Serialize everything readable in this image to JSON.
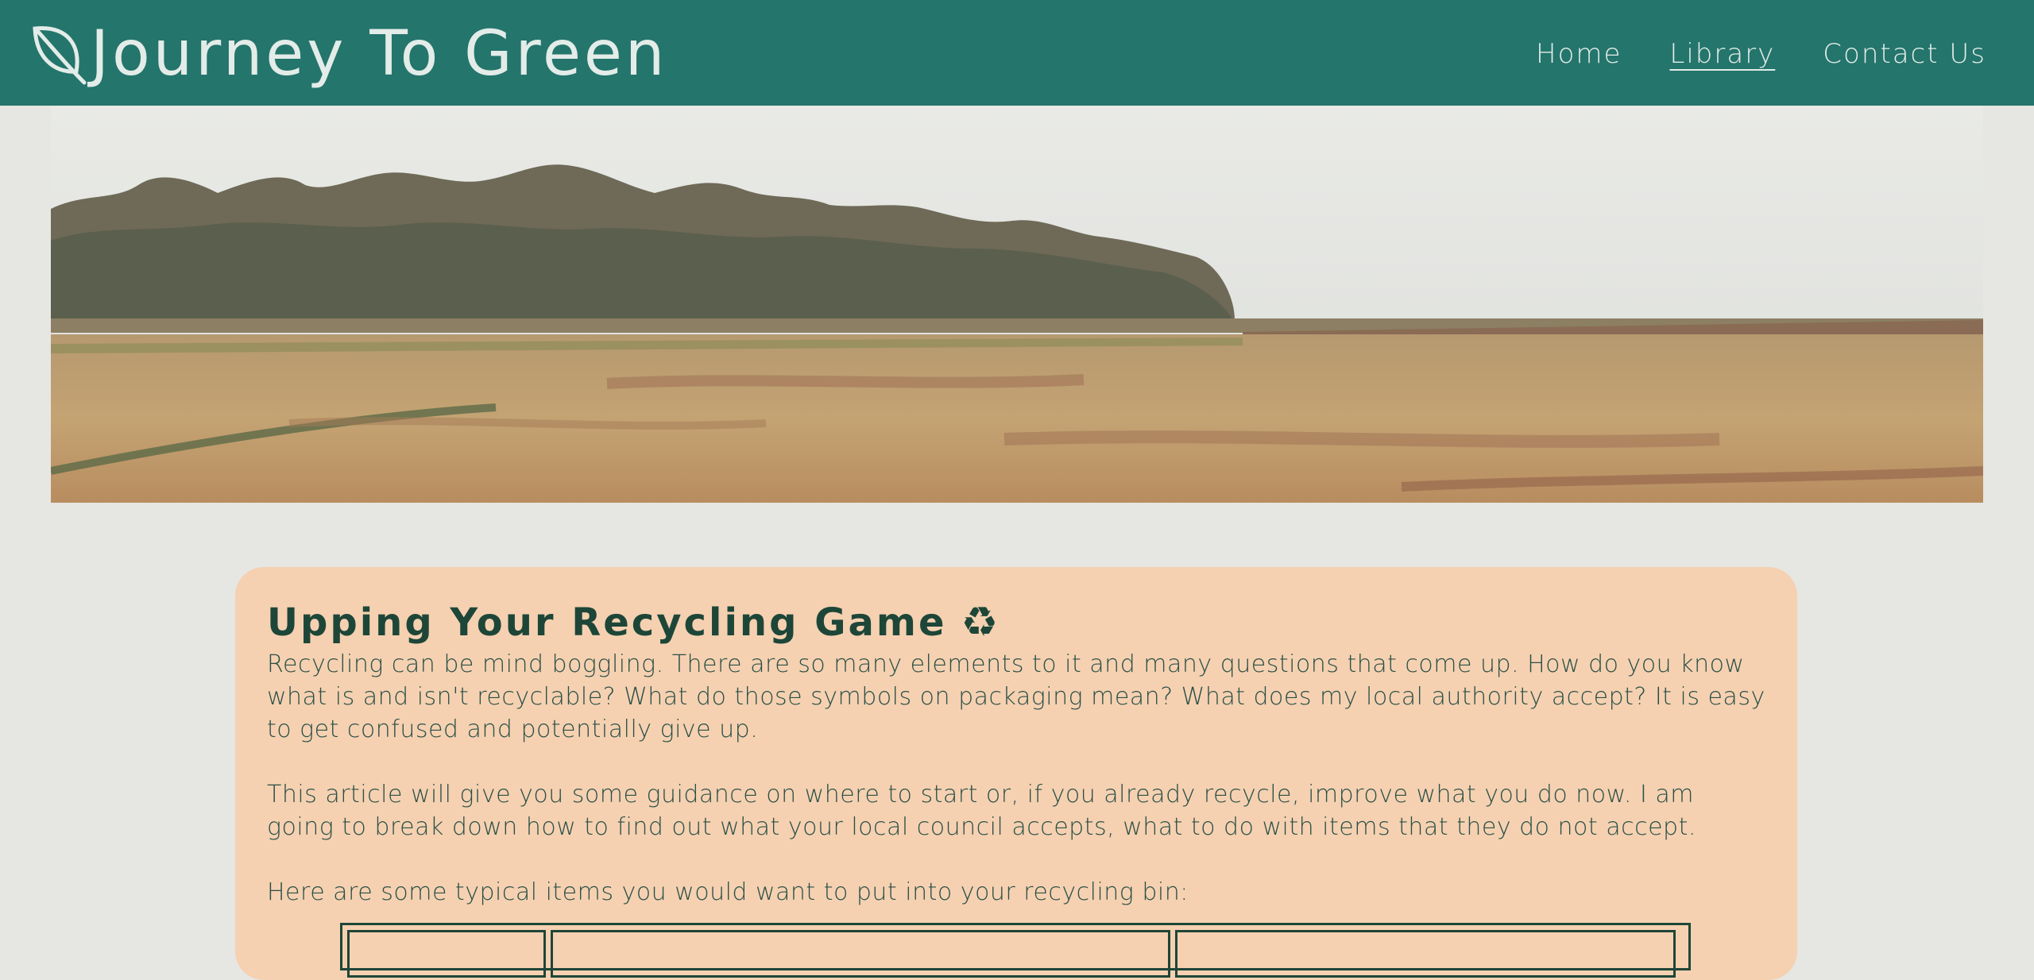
{
  "header": {
    "title": "Journey To Green",
    "logo_icon": "leaf-icon",
    "bg_color": "#24756c",
    "text_color": "#e3ece8",
    "nav": [
      {
        "label": "Home",
        "active": false
      },
      {
        "label": "Library",
        "active": true
      },
      {
        "label": "Contact Us",
        "active": false
      }
    ]
  },
  "hero": {
    "icon": "landscape-photo"
  },
  "article": {
    "title": "Upping Your Recycling Game",
    "title_icon": "recycle-icon",
    "title_icon_glyph": "♻",
    "card_color": "#f5d1b1",
    "paragraphs": [
      "Recycling can be mind boggling. There are so many elements to it and many questions that come up. How do you know what is and isn't recyclable? What do those symbols on packaging mean? What does my local authority accept? It is easy to get confused and potentially give up.",
      "This article will give you some guidance on where to start or, if you already recycle, improve what you do now. I am going to break down how to find out what your local council accepts, what to do with items that they do not accept.",
      "Here are some typical items you would want to put into your recycling bin:"
    ]
  }
}
